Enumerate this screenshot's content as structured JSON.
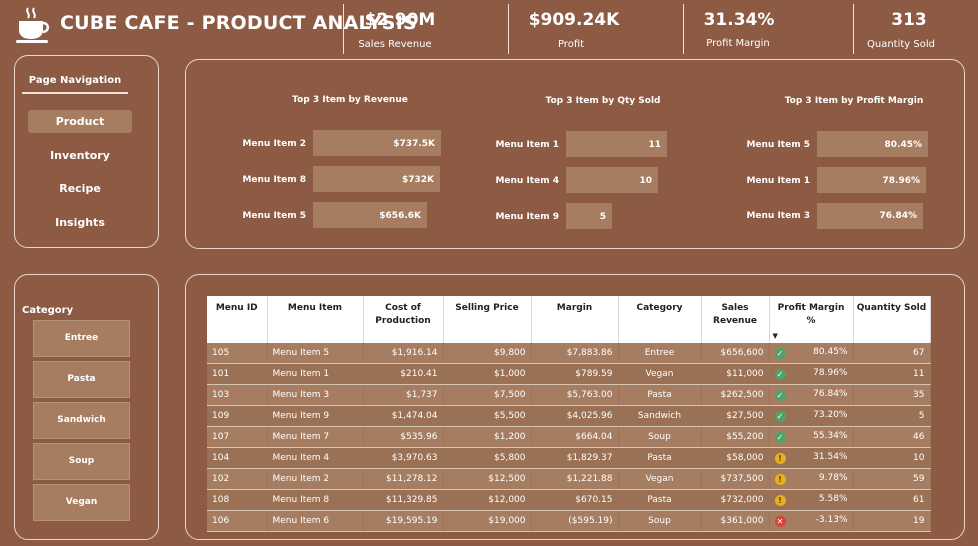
{
  "header": {
    "title": "CUBE CAFE - PRODUCT ANALYSIS",
    "logo_icon": "coffee-cup-icon",
    "kpis": [
      {
        "value": "$2.90M",
        "label": "Sales Revenue"
      },
      {
        "value": "$909.24K",
        "label": "Profit"
      },
      {
        "value": "31.34%",
        "label": "Profit Margin"
      },
      {
        "value": "313",
        "label": "Quantity Sold"
      }
    ]
  },
  "nav": {
    "title": "Page Navigation",
    "items": [
      {
        "label": "Product",
        "active": true
      },
      {
        "label": "Inventory"
      },
      {
        "label": "Recipe"
      },
      {
        "label": "Insights"
      }
    ]
  },
  "top3": [
    {
      "title": "Top 3 Item by Revenue",
      "items": [
        {
          "label": "Menu Item 2",
          "value_text": "$737.5K",
          "value": 737.5
        },
        {
          "label": "Menu Item 8",
          "value_text": "$732K",
          "value": 732
        },
        {
          "label": "Menu Item 5",
          "value_text": "$656.6K",
          "value": 656.6
        }
      ]
    },
    {
      "title": "Top 3 Item by Qty Sold",
      "items": [
        {
          "label": "Menu Item 1",
          "value_text": "11",
          "value": 11
        },
        {
          "label": "Menu Item 4",
          "value_text": "10",
          "value": 10
        },
        {
          "label": "Menu Item 9",
          "value_text": "5",
          "value": 5
        }
      ]
    },
    {
      "title": "Top 3 Item by Profit Margin",
      "items": [
        {
          "label": "Menu Item 5",
          "value_text": "80.45%",
          "value": 80.45
        },
        {
          "label": "Menu Item 1",
          "value_text": "78.96%",
          "value": 78.96
        },
        {
          "label": "Menu Item 3",
          "value_text": "76.84%",
          "value": 76.84
        }
      ]
    }
  ],
  "category": {
    "title": "Category",
    "items": [
      "Entree",
      "Pasta",
      "Sandwich",
      "Soup",
      "Vegan"
    ]
  },
  "table": {
    "columns": [
      "Menu ID",
      "Menu Item",
      "Cost of Production",
      "Selling Price",
      "Margin",
      "Category",
      "Sales Revenue",
      "Profit Margin %",
      "Quantity Sold"
    ],
    "rows": [
      [
        "105",
        "Menu Item 5",
        "$1,916.14",
        "$9,800",
        "$7,883.86",
        "Entree",
        "$656,600",
        "80.45%",
        "67"
      ],
      [
        "101",
        "Menu Item 1",
        "$210.41",
        "$1,000",
        "$789.59",
        "Vegan",
        "$11,000",
        "78.96%",
        "11"
      ],
      [
        "103",
        "Menu Item 3",
        "$1,737",
        "$7,500",
        "$5,763.00",
        "Pasta",
        "$262,500",
        "76.84%",
        "35"
      ],
      [
        "109",
        "Menu Item 9",
        "$1,474.04",
        "$5,500",
        "$4,025.96",
        "Sandwich",
        "$27,500",
        "73.20%",
        "5"
      ],
      [
        "107",
        "Menu Item 7",
        "$535.96",
        "$1,200",
        "$664.04",
        "Soup",
        "$55,200",
        "55.34%",
        "46"
      ],
      [
        "104",
        "Menu Item 4",
        "$3,970.63",
        "$5,800",
        "$1,829.37",
        "Pasta",
        "$58,000",
        "31.54%",
        "10"
      ],
      [
        "102",
        "Menu Item 2",
        "$11,278.12",
        "$12,500",
        "$1,221.88",
        "Vegan",
        "$737,500",
        "9.78%",
        "59"
      ],
      [
        "108",
        "Menu Item 8",
        "$11,329.85",
        "$12,000",
        "$670.15",
        "Pasta",
        "$732,000",
        "5.58%",
        "61"
      ],
      [
        "106",
        "Menu Item 6",
        "$19,595.19",
        "$19,000",
        "($595.19)",
        "Soup",
        "$361,000",
        "-3.13%",
        "19"
      ]
    ],
    "status": [
      "good",
      "good",
      "good",
      "good",
      "good",
      "warn",
      "warn",
      "warn",
      "bad"
    ],
    "status_icons": {
      "good": "check-circle-icon",
      "warn": "exclamation-circle-icon",
      "bad": "x-circle-icon"
    },
    "status_colors": {
      "good": "#4fa36a",
      "warn": "#e8b01f",
      "bad": "#d7423a"
    }
  },
  "colors": {
    "background": "#8d5a44",
    "tile": "#a67d61",
    "border": "#e8d6c8"
  }
}
